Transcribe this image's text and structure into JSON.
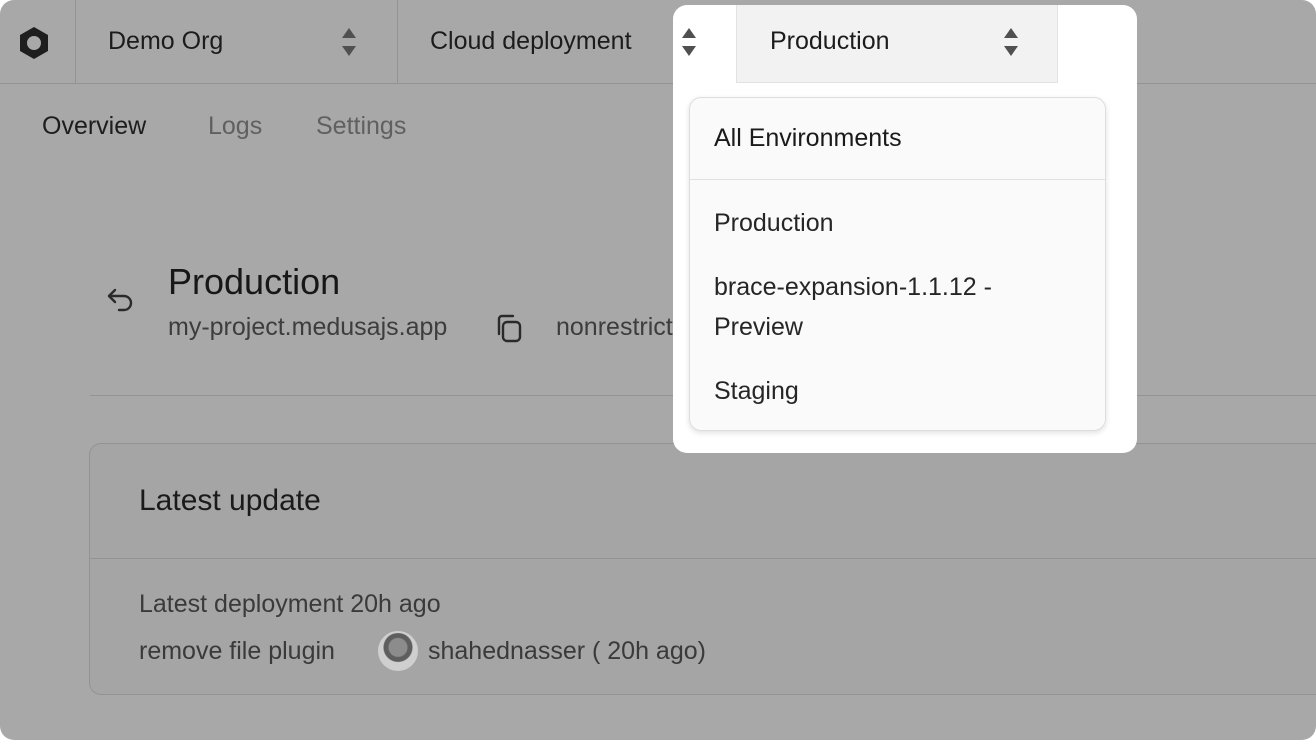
{
  "topbar": {
    "org_label": "Demo Org",
    "project_label": "Cloud deployment",
    "environment_label": "Production"
  },
  "tabs": [
    {
      "label": "Overview",
      "active": true
    },
    {
      "label": "Logs",
      "active": false
    },
    {
      "label": "Settings",
      "active": false
    }
  ],
  "environment": {
    "title": "Production",
    "domain": "my-project.medusajs.app",
    "flag": "nonrestricted"
  },
  "latest_update": {
    "title": "Latest update",
    "deployment_text": "Latest deployment 20h ago",
    "commit_message": "remove file plugin",
    "author_text": "shahednasser ( 20h ago)"
  },
  "env_menu": {
    "header": "All Environments",
    "items": [
      "Production",
      "brace-expansion-1.1.12 - Preview",
      "Staging"
    ]
  },
  "icons": {
    "logo": "medusa-logo-icon",
    "sort": "sort-updown-icon",
    "back": "undo-arrow-icon",
    "copy": "copy-icon"
  },
  "colors": {
    "overlay": "#a8a8a8",
    "menu_bg": "#fafafa",
    "text_dark": "#1b1b1b"
  }
}
